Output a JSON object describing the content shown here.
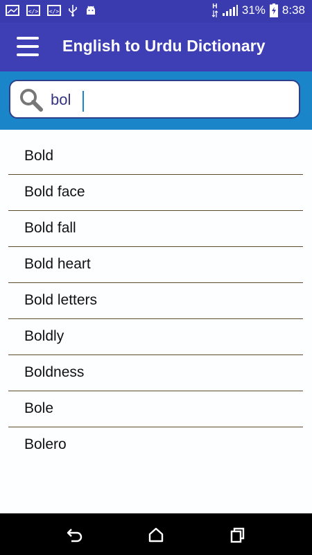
{
  "status_bar": {
    "network_label": "H",
    "battery_percent": "31%",
    "time": "8:38"
  },
  "app_bar": {
    "title": "English to Urdu Dictionary",
    "menu_icon": "hamburger-menu-icon"
  },
  "search": {
    "value": "bol",
    "icon": "search-icon"
  },
  "results": [
    "Bold",
    "Bold face",
    "Bold fall",
    "Bold heart",
    "Bold letters",
    "Boldly",
    "Boldness",
    "Bole",
    "Bolero"
  ],
  "nav_bar": {
    "back_icon": "back-icon",
    "home_icon": "home-icon",
    "recents_icon": "recents-icon"
  },
  "colors": {
    "status_bar": "#3b3bb0",
    "app_bar": "#3f3fb5",
    "search_area": "#1a85c8",
    "search_border": "#2d3f8a",
    "divider": "#5a4a2a",
    "nav_bar": "#000000"
  }
}
